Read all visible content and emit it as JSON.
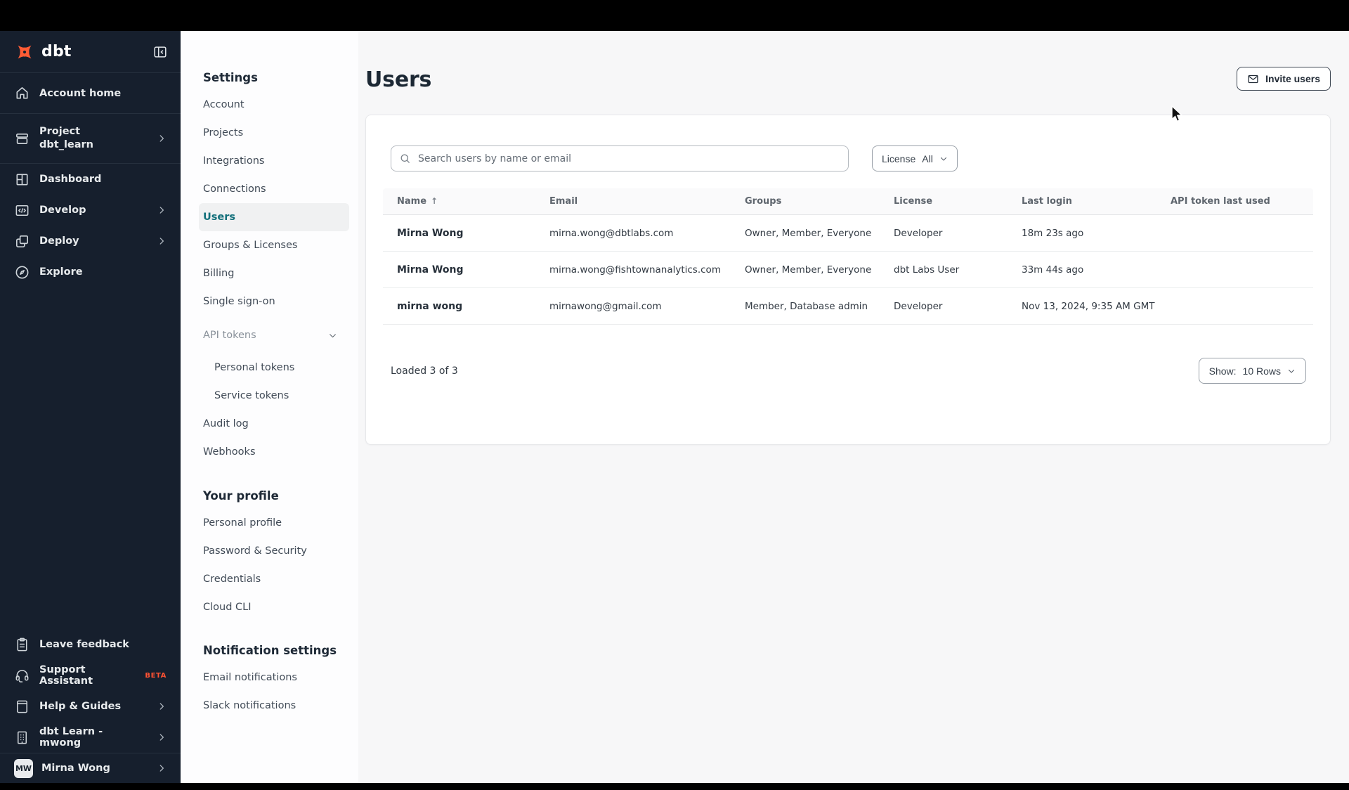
{
  "colors": {
    "accent_teal": "#13707b",
    "brand_coral": "#ff5c35",
    "sidebar_bg": "#161f2d",
    "main_bg": "#f7f7f8"
  },
  "sidebar": {
    "logo_text": "dbt",
    "account_home": "Account home",
    "project_label": "Project",
    "project_name": "dbt_learn",
    "nav": [
      "Dashboard",
      "Develop",
      "Deploy",
      "Explore"
    ],
    "footer": [
      "Leave feedback",
      "Support Assistant",
      "Help & Guides",
      "dbt Learn - mwong"
    ],
    "beta_badge": "BETA",
    "user": {
      "initials": "MW",
      "name": "Mirna Wong"
    }
  },
  "settings_nav": {
    "title": "Settings",
    "items": [
      "Account",
      "Projects",
      "Integrations",
      "Connections",
      "Users",
      "Groups & Licenses",
      "Billing",
      "Single sign-on"
    ],
    "api_tokens": {
      "label": "API tokens",
      "children": [
        "Personal tokens",
        "Service tokens"
      ]
    },
    "items_after": [
      "Audit log",
      "Webhooks"
    ],
    "profile": {
      "title": "Your profile",
      "items": [
        "Personal profile",
        "Password & Security",
        "Credentials",
        "Cloud CLI"
      ]
    },
    "notifications": {
      "title": "Notification settings",
      "items": [
        "Email notifications",
        "Slack notifications"
      ]
    }
  },
  "main": {
    "title": "Users",
    "invite_button": "Invite users",
    "search_placeholder": "Search users by name or email",
    "license_filter": {
      "label": "License",
      "value": "All"
    },
    "table": {
      "headers": [
        "Name",
        "Email",
        "Groups",
        "License",
        "Last login",
        "API token last used"
      ],
      "sort_indicator": "↑",
      "rows": [
        {
          "name": "Mirna Wong",
          "email": "mirna.wong@dbtlabs.com",
          "groups": "Owner, Member, Everyone",
          "license": "Developer",
          "last_login": "18m 23s ago",
          "api_token_last_used": ""
        },
        {
          "name": "Mirna Wong",
          "email": "mirna.wong@fishtownanalytics.com",
          "groups": "Owner, Member, Everyone",
          "license": "dbt Labs User",
          "last_login": "33m 44s ago",
          "api_token_last_used": ""
        },
        {
          "name": "mirna wong",
          "email": "mirnawong@gmail.com",
          "groups": "Member, Database admin",
          "license": "Developer",
          "last_login": "Nov 13, 2024, 9:35 AM GMT",
          "api_token_last_used": ""
        }
      ]
    },
    "footer": {
      "loaded_text": "Loaded 3 of 3",
      "show_label": "Show:",
      "show_value": "10 Rows"
    }
  }
}
